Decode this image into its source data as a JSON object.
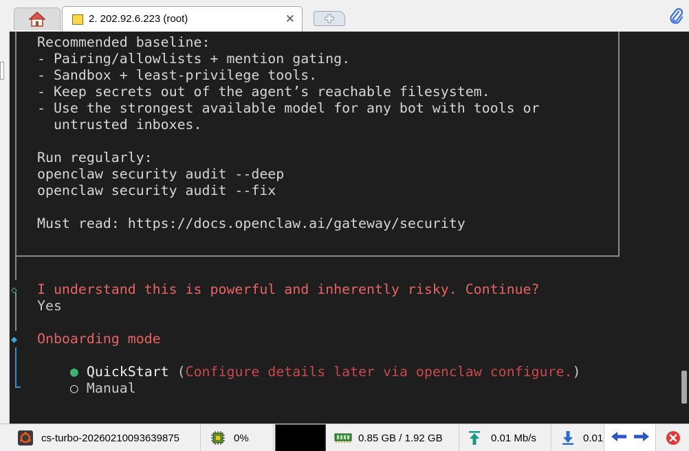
{
  "tabs": {
    "active_title": "2. 202.92.6.223 (root)"
  },
  "terminal": {
    "baseline_lines": [
      "Recommended baseline:",
      "- Pairing/allowlists + mention gating.",
      "- Sandbox + least-privilege tools.",
      "- Keep secrets out of the agent’s reachable filesystem.",
      "- Use the strongest available model for any bot with tools or",
      "  untrusted inboxes."
    ],
    "run_regularly_lines": [
      "Run regularly:",
      "openclaw security audit --deep",
      "openclaw security audit --fix"
    ],
    "must_read": "Must read: https://docs.openclaw.ai/gateway/security",
    "prompt_question": "I understand this is powerful and inherently risky. Continue?",
    "prompt_answer": "Yes",
    "onboarding_title": "Onboarding mode",
    "option_quickstart_label": "QuickStart",
    "option_quickstart_hint": "Configure details later via openclaw configure.",
    "option_manual_label": "Manual",
    "symbols": {
      "done_marker": "◇",
      "active_marker": "◆",
      "radio_selected": "●",
      "radio_unselected": "○"
    },
    "colors": {
      "background": "#1e1e1e",
      "text": "#d6d6d6",
      "accent_red": "#e86464",
      "hint_red": "#c8484c",
      "marker_green": "#3cb371",
      "marker_cyan": "#3aa6d8"
    }
  },
  "statusbar": {
    "session_name": "cs-turbo-20260210093639875",
    "cpu": "0%",
    "memory": "0.85 GB / 1.92 GB",
    "upload": "0.01 Mb/s",
    "download": "0.01"
  }
}
